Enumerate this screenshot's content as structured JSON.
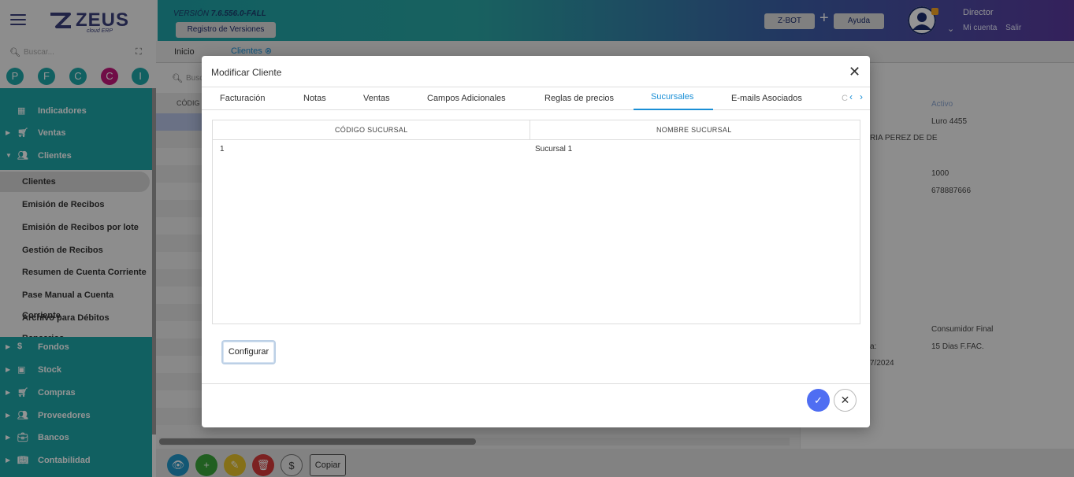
{
  "header": {
    "logo_text": "ZEUS",
    "logo_sub": "cloud ERP",
    "version_prefix": "VERSIÓN",
    "version_number": "7.6.556.0-FALL",
    "registro_label": "Registro de Versiones",
    "zbot_label": "Z-BOT",
    "plus_label": "+",
    "ayuda_label": "Ayuda",
    "user_role": "Director",
    "mi_cuenta": "Mi cuenta",
    "salir": "Salir"
  },
  "sidebar": {
    "search_placeholder": "Buscar...",
    "quick_buttons": [
      {
        "label": "P",
        "color": "#1ea6a8"
      },
      {
        "label": "F",
        "color": "#1ea6a8"
      },
      {
        "label": "C",
        "color": "#1ea6a8"
      },
      {
        "label": "C",
        "color": "#c2187a"
      },
      {
        "label": "I",
        "color": "#1ea6a8"
      }
    ],
    "top_items": [
      {
        "label": "Indicadores",
        "icon": "dashboard-icon"
      },
      {
        "label": "Ventas",
        "icon": "cart-icon"
      },
      {
        "label": "Clientes",
        "icon": "people-icon"
      }
    ],
    "clientes_sub": [
      "Clientes",
      "Emisión de Recibos",
      "Emisión de Recibos por lote",
      "Gestión de Recibos",
      "Resumen de Cuenta Corriente",
      "Pase Manual a Cuenta Corriente",
      "Archivo para Débitos Bancarios"
    ],
    "bottom_items": [
      {
        "label": "Fondos",
        "icon": "dollar-icon"
      },
      {
        "label": "Stock",
        "icon": "box-icon"
      },
      {
        "label": "Compras",
        "icon": "cart-icon"
      },
      {
        "label": "Proveedores",
        "icon": "people-icon"
      },
      {
        "label": "Bancos",
        "icon": "briefcase-icon"
      },
      {
        "label": "Contabilidad",
        "icon": "book-icon"
      }
    ]
  },
  "tabs": {
    "inicio": "Inicio",
    "clientes": "Clientes"
  },
  "background": {
    "search_placeholder": "Busc",
    "column_code": "CÓDIG",
    "detail": {
      "activo": "Activo",
      "address": "Luro 4455",
      "name_fragment": "RIA PEREZ DE DE",
      "value_1000": "1000",
      "phone": "678887666",
      "cond_iva": "Consumidor Final",
      "term_label_fragment": "a:",
      "term": "15 Dias F.FAC.",
      "date_fragment": "7/2024"
    },
    "copiar_label": "Copiar"
  },
  "modal": {
    "title": "Modificar Cliente",
    "tabs": [
      "Facturación",
      "Notas",
      "Ventas",
      "Campos Adicionales",
      "Reglas de precios",
      "Sucursales",
      "E-mails Asociados"
    ],
    "active_tab": "Sucursales",
    "tab_overflow": "C",
    "grid": {
      "columns": [
        "CÓDIGO SUCURSAL",
        "NOMBRE SUCURSAL"
      ],
      "rows": [
        {
          "codigo": "1",
          "nombre": "Sucursal 1"
        }
      ]
    },
    "configurar_label": "Configurar"
  }
}
